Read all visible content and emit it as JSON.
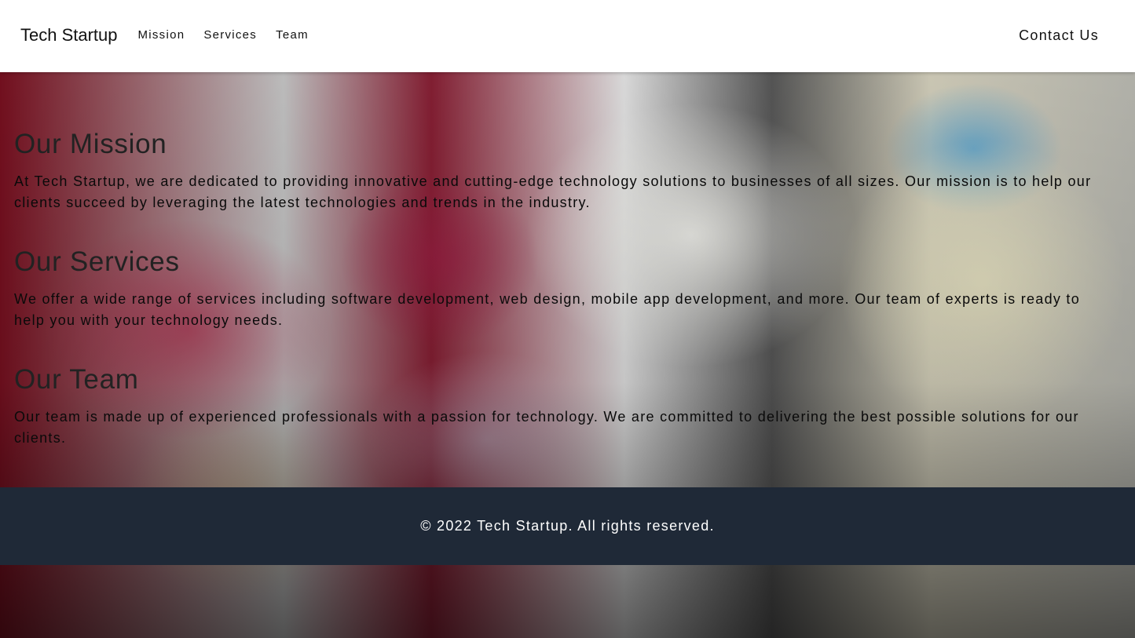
{
  "header": {
    "brand": "Tech Startup",
    "nav": [
      {
        "label": "Mission"
      },
      {
        "label": "Services"
      },
      {
        "label": "Team"
      }
    ],
    "contact_label": "Contact Us"
  },
  "main": {
    "sections": [
      {
        "title": "Our Mission",
        "body": "At Tech Startup, we are dedicated to providing innovative and cutting-edge technology solutions to businesses of all sizes. Our mission is to help our clients succeed by leveraging the latest technologies and trends in the industry."
      },
      {
        "title": "Our Services",
        "body": "We offer a wide range of services including software development, web design, mobile app development, and more. Our team of experts is ready to help you with your technology needs."
      },
      {
        "title": "Our Team",
        "body": "Our team is made up of experienced professionals with a passion for technology. We are committed to delivering the best possible solutions for our clients."
      }
    ]
  },
  "footer": {
    "copyright": "© 2022 Tech Startup. All rights reserved."
  },
  "colors": {
    "footer_bg": "#1f2937",
    "header_bg": "#ffffff"
  }
}
